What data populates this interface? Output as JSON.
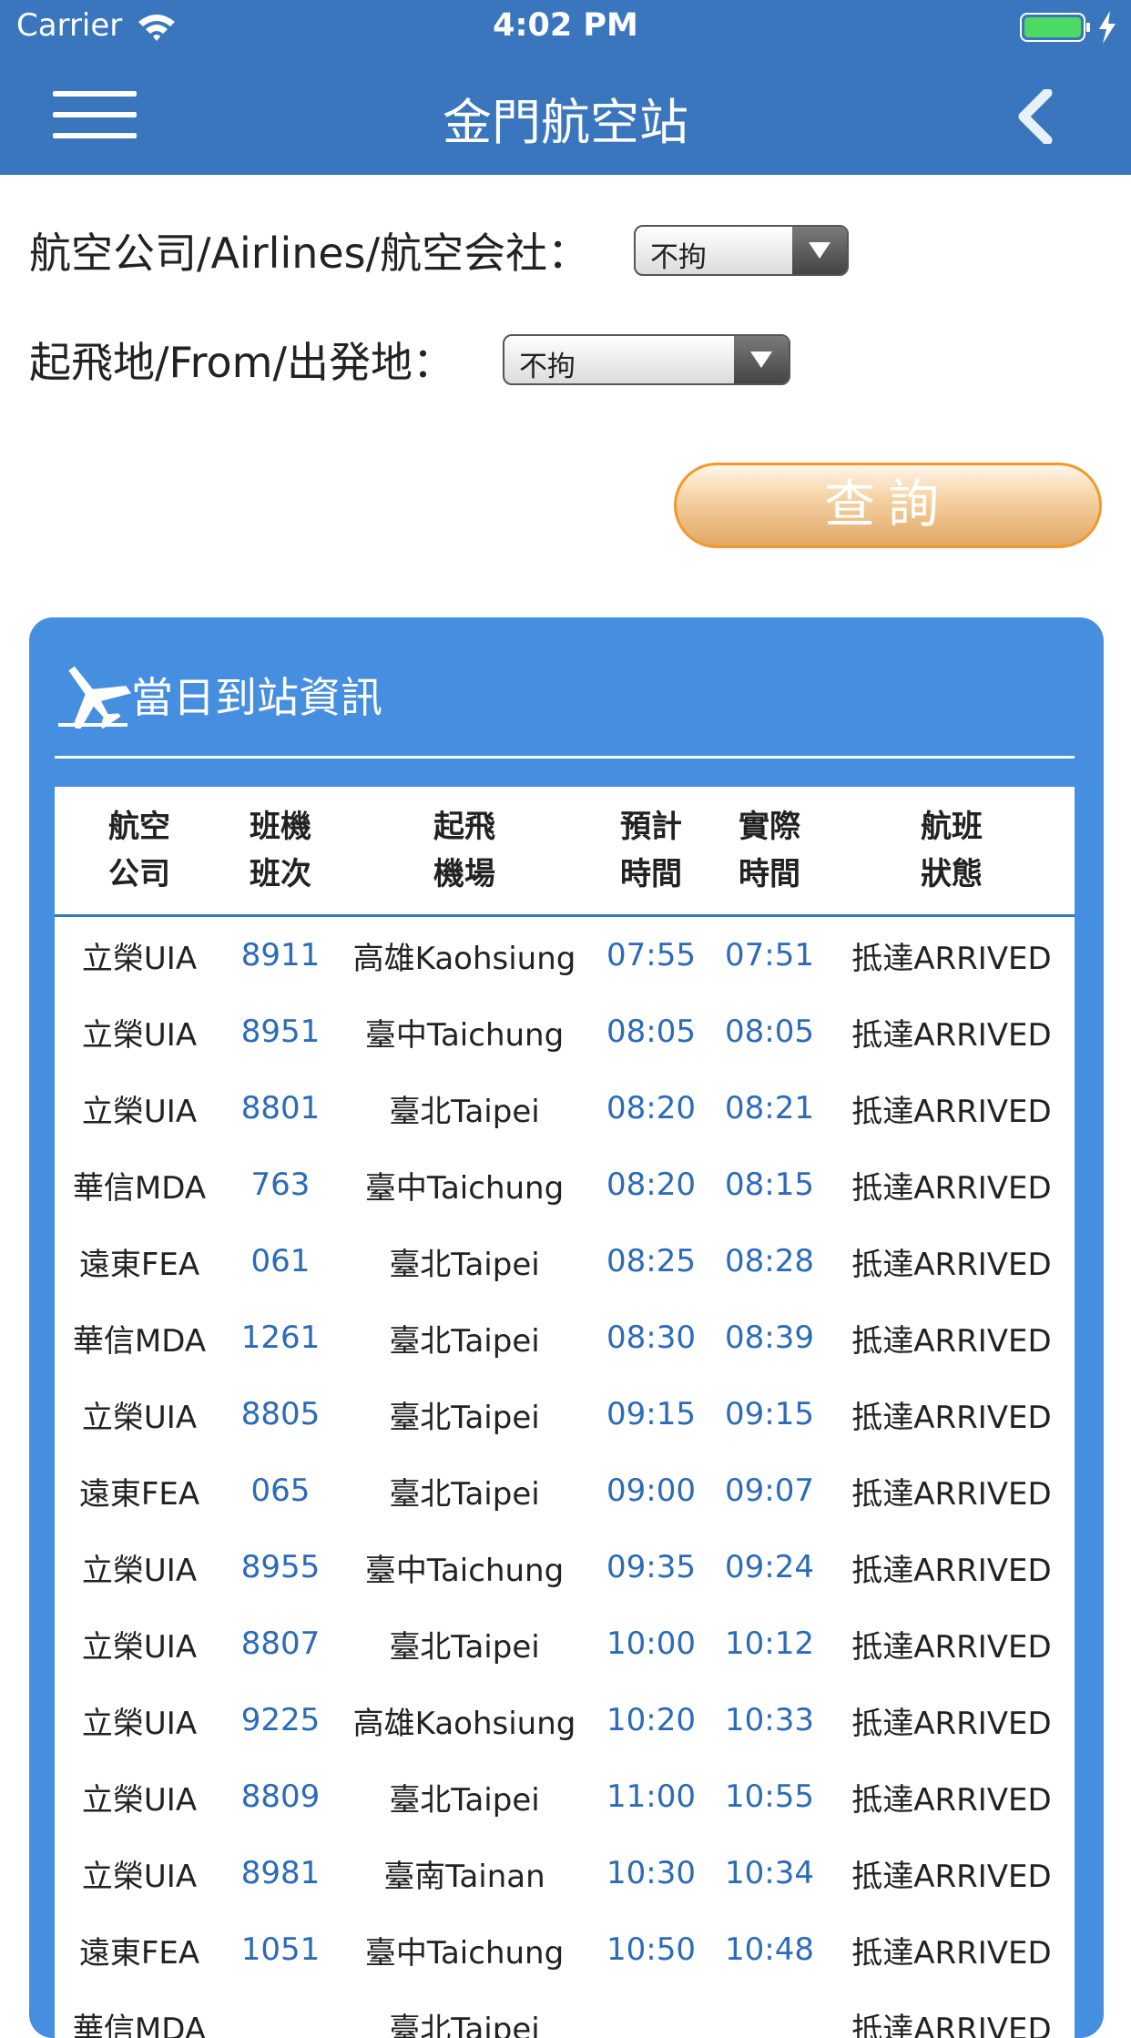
{
  "status_bar": {
    "carrier": "Carrier",
    "time": "4:02 PM"
  },
  "navbar": {
    "title": "金門航空站"
  },
  "filters": {
    "airline_label": "航空公司/Airlines/航空会社：",
    "airline_value": "不拘",
    "from_label": "起飛地/From/出発地：",
    "from_value": "不拘"
  },
  "query_button": "查詢",
  "panel": {
    "title": "當日到站資訊"
  },
  "table": {
    "headers": [
      [
        "航空",
        "公司"
      ],
      [
        "班機",
        "班次"
      ],
      [
        "起飛",
        "機場"
      ],
      [
        "預計",
        "時間"
      ],
      [
        "實際",
        "時間"
      ],
      [
        "航班",
        "狀態"
      ]
    ],
    "rows": [
      [
        "立榮UIA",
        "8911",
        "高雄Kaohsiung",
        "07:55",
        "07:51",
        "抵達ARRIVED"
      ],
      [
        "立榮UIA",
        "8951",
        "臺中Taichung",
        "08:05",
        "08:05",
        "抵達ARRIVED"
      ],
      [
        "立榮UIA",
        "8801",
        "臺北Taipei",
        "08:20",
        "08:21",
        "抵達ARRIVED"
      ],
      [
        "華信MDA",
        "763",
        "臺中Taichung",
        "08:20",
        "08:15",
        "抵達ARRIVED"
      ],
      [
        "遠東FEA",
        "061",
        "臺北Taipei",
        "08:25",
        "08:28",
        "抵達ARRIVED"
      ],
      [
        "華信MDA",
        "1261",
        "臺北Taipei",
        "08:30",
        "08:39",
        "抵達ARRIVED"
      ],
      [
        "立榮UIA",
        "8805",
        "臺北Taipei",
        "09:15",
        "09:15",
        "抵達ARRIVED"
      ],
      [
        "遠東FEA",
        "065",
        "臺北Taipei",
        "09:00",
        "09:07",
        "抵達ARRIVED"
      ],
      [
        "立榮UIA",
        "8955",
        "臺中Taichung",
        "09:35",
        "09:24",
        "抵達ARRIVED"
      ],
      [
        "立榮UIA",
        "8807",
        "臺北Taipei",
        "10:00",
        "10:12",
        "抵達ARRIVED"
      ],
      [
        "立榮UIA",
        "9225",
        "高雄Kaohsiung",
        "10:20",
        "10:33",
        "抵達ARRIVED"
      ],
      [
        "立榮UIA",
        "8809",
        "臺北Taipei",
        "11:00",
        "10:55",
        "抵達ARRIVED"
      ],
      [
        "立榮UIA",
        "8981",
        "臺南Tainan",
        "10:30",
        "10:34",
        "抵達ARRIVED"
      ],
      [
        "遠東FEA",
        "1051",
        "臺中Taichung",
        "10:50",
        "10:48",
        "抵達ARRIVED"
      ],
      [
        "華信MDA",
        "",
        "臺北Taipei",
        "",
        "",
        "抵達ARRIVED"
      ]
    ]
  },
  "colors": {
    "header_blue": "#3a76bd",
    "panel_blue": "#468ee0",
    "time_blue": "#2c6bb8",
    "button_orange": "#f19a2a"
  }
}
